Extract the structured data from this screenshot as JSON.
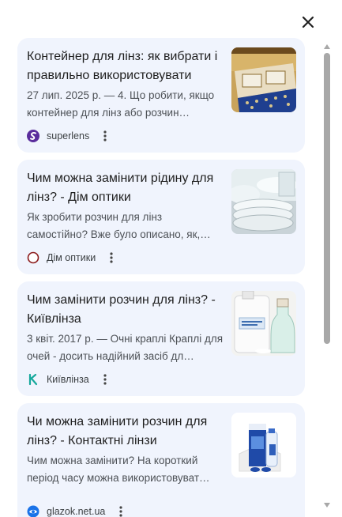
{
  "close": {
    "icon": "close-icon"
  },
  "results": [
    {
      "title": "Контейнер для лінз: як вибрати і правильно використовувати",
      "snippet": "27 лип. 2025 р. — 4. Що робити, якщо контейнер для лінз або розчин…",
      "source": "superlens",
      "favicon": "superlens-logo-icon",
      "thumbnail": "lens-case-photo"
    },
    {
      "title": "Чим можна замінити рідину для лінз? - Дім оптики",
      "snippet": "Як зробити розчин для лінз самостійно? Вже було описано, як,…",
      "source": "Дім оптики",
      "favicon": "dim-optyky-logo-icon",
      "thumbnail": "white-dishes-photo"
    },
    {
      "title": "Чим замінити розчин для лінз? - Київлінза",
      "snippet": "3 квіт. 2017 р. — Очні краплі Краплі для очей - досить надійний засіб дл…",
      "source": "Київлінза",
      "favicon": "kyivlinza-logo-icon",
      "thumbnail": "distilled-water-bottles-photo"
    },
    {
      "title": "Чи можна замінити розчин для лінз? - Контактні лінзи",
      "snippet": "Чим можна замінити? На короткий період часу можна використовуват…",
      "source": "glazok.net.ua",
      "favicon": "glazok-logo-icon",
      "thumbnail": "lens-solution-box-photo"
    }
  ],
  "more_icon": "more-vertical-icon",
  "colors": {
    "card_bg": "#f0f4fd",
    "title": "#1f1f1f",
    "snippet": "#4d5156",
    "superlens": "#5a2d9c",
    "kyivlinza": "#16a89c",
    "glazok": "#1a73e8"
  }
}
